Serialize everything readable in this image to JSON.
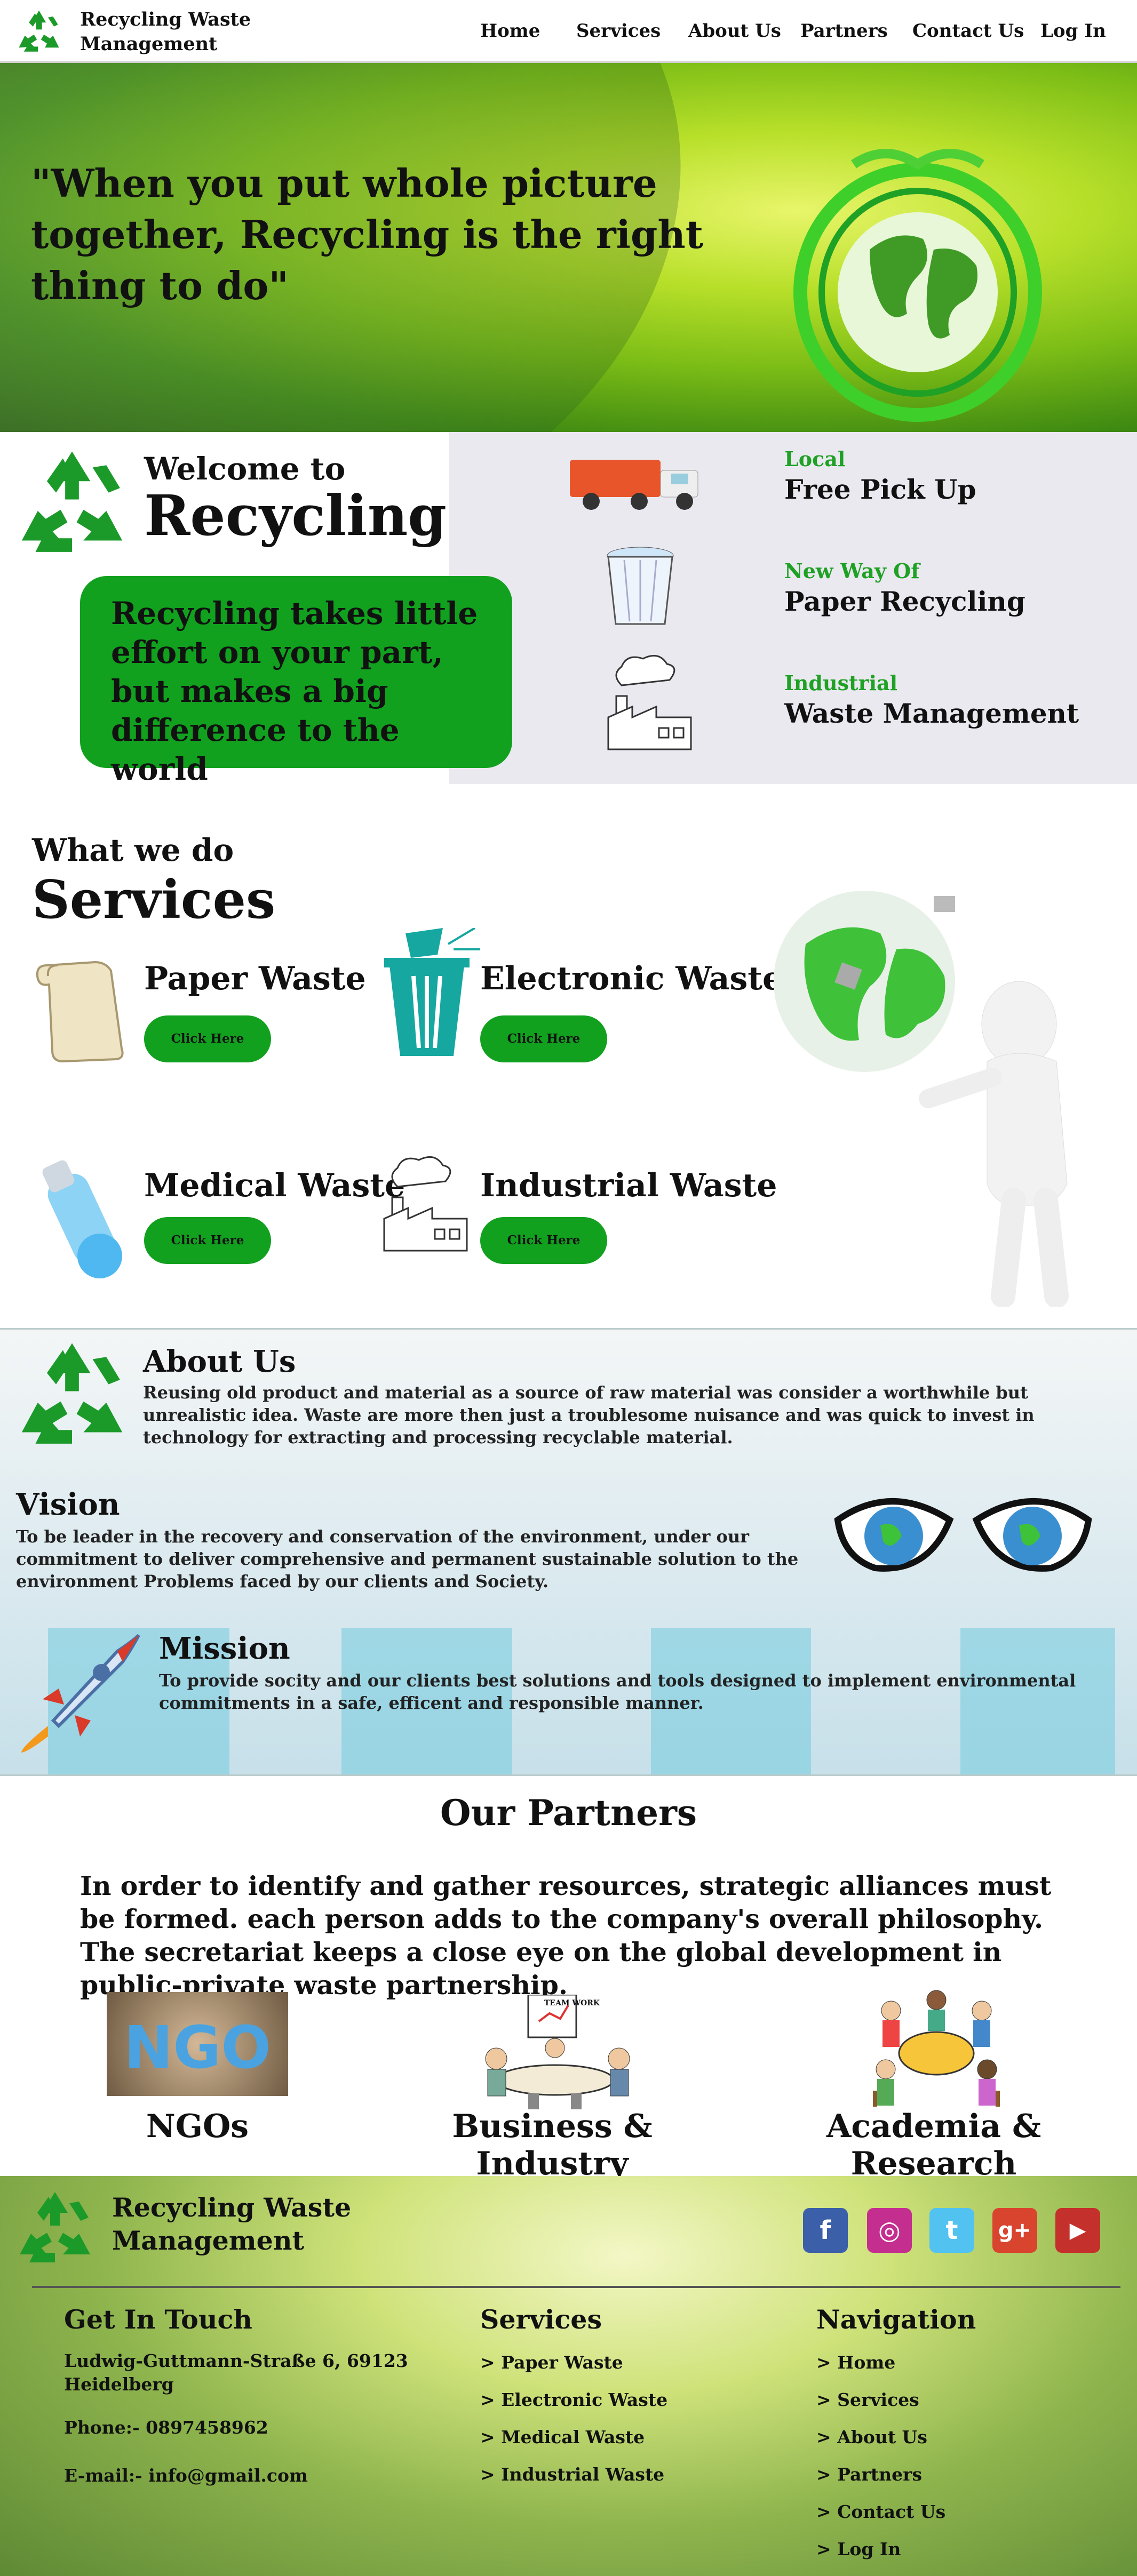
{
  "brand": {
    "name_line1": "Recycling Waste",
    "name_line2": "Management"
  },
  "nav": [
    "Home",
    "Services",
    "About Us",
    "Partners",
    "Contact Us",
    "Log In"
  ],
  "hero": {
    "quote": "\"When you put whole picture together, Recycling is the right thing to do\""
  },
  "welcome": {
    "small": "Welcome to",
    "big": "Recycling",
    "card": "Recycling takes little effort on your part, but makes a big difference to the world"
  },
  "features": [
    {
      "label": "Local",
      "title": "Free Pick Up",
      "icon": "truck-icon"
    },
    {
      "label": "New Way Of",
      "title": "Paper Recycling",
      "icon": "bin-icon"
    },
    {
      "label": "Industrial",
      "title": "Waste Management",
      "icon": "factory-icon"
    }
  ],
  "services": {
    "eyebrow": "What we do",
    "title": "Services",
    "items": [
      {
        "name": "Paper Waste",
        "button": "Click Here",
        "icon": "scroll-icon"
      },
      {
        "name": "Electronic Waste",
        "button": "Click Here",
        "icon": "trash-can-icon"
      },
      {
        "name": "Medical Waste",
        "button": "Click Here",
        "icon": "syringe-icon"
      },
      {
        "name": "Industrial Waste",
        "button": "Click Here",
        "icon": "factory-icon"
      }
    ]
  },
  "about": {
    "title": "About Us",
    "text": "Reusing old product and material as a source of raw material was consider a worthwhile but unrealistic idea. Waste are more then just a troublesome nuisance and was quick to invest in technology for extracting and processing recyclable material.",
    "vision_title": "Vision",
    "vision_text": "To be leader in the recovery and conservation of the environment, under our commitment to deliver comprehensive and permanent sustainable solution to the environment Problems faced by our clients and Society.",
    "mission_title": "Mission",
    "mission_text": "To provide socity and our clients best solutions and tools designed to implement environmental commitments in a safe, efficent and responsible manner."
  },
  "partners": {
    "title": "Our Partners",
    "text": "In order to identify and gather resources, strategic alliances must be formed. each person adds to the company's overall philosophy. The secretariat keeps a close eye on the global development in public-private waste partnership.",
    "items": [
      {
        "name": "NGOs",
        "image_text": "NGO"
      },
      {
        "name": "Business & Industry",
        "image_text": "TEAM WORK"
      },
      {
        "name": "Academia & Research"
      }
    ]
  },
  "footer": {
    "brand_line1": "Recycling Waste",
    "brand_line2": "Management",
    "contact_title": "Get In Touch",
    "address_line1": "Ludwig-Guttmann-Straße 6, 69123",
    "address_line2": "Heidelberg",
    "phone": "Phone:- 0897458962",
    "email": "E-mail:- info@gmail.com",
    "services_title": "Services",
    "services": [
      "> Paper Waste",
      "> Electronic Waste",
      "> Medical Waste",
      "> Industrial Waste"
    ],
    "nav_title": "Navigation",
    "nav": [
      "> Home",
      "> Services",
      "> About Us",
      "> Partners",
      "> Contact Us",
      "> Log In"
    ],
    "social": [
      {
        "icon": "facebook-icon",
        "glyph": "f",
        "color": "#3b5fa8"
      },
      {
        "icon": "instagram-icon",
        "glyph": "◎",
        "color": "#c42e8e"
      },
      {
        "icon": "twitter-icon",
        "glyph": "t",
        "color": "#52c2f0"
      },
      {
        "icon": "google-plus-icon",
        "glyph": "g+",
        "color": "#d9442e"
      },
      {
        "icon": "youtube-icon",
        "glyph": "▶",
        "color": "#c4302b"
      }
    ]
  },
  "colors": {
    "green": "#11a11e",
    "label_green": "#1ea125",
    "panel": "#ebe9f0"
  }
}
